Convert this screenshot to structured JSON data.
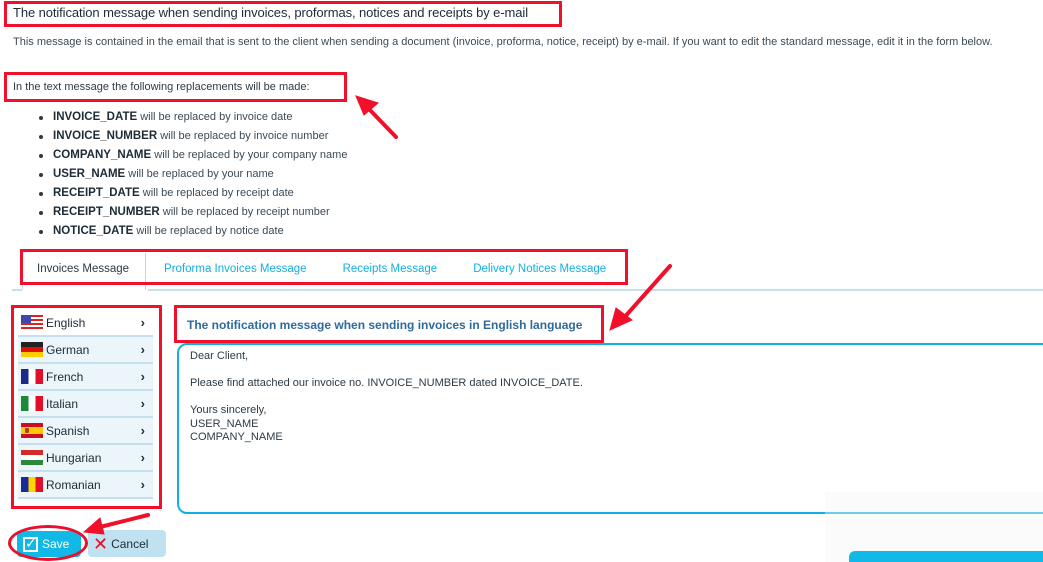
{
  "page": {
    "title": "The notification message when sending invoices, proformas, notices and receipts by e-mail",
    "description": "This message is contained in the email that is sent to the client when sending a document (invoice, proforma, notice, receipt) by e-mail. If you want to edit the standard message, edit it in the form below.",
    "replacements_intro": "In the text message the following replacements will be made:",
    "replacements": [
      {
        "token": "INVOICE_DATE",
        "text": " will be replaced by invoice date"
      },
      {
        "token": "INVOICE_NUMBER",
        "text": " will be replaced by invoice number"
      },
      {
        "token": "COMPANY_NAME",
        "text": " will be replaced by your company name"
      },
      {
        "token": "USER_NAME",
        "text": " will be replaced by your name"
      },
      {
        "token": "RECEIPT_DATE",
        "text": " will be replaced by receipt date"
      },
      {
        "token": "RECEIPT_NUMBER",
        "text": " will be replaced by receipt number"
      },
      {
        "token": "NOTICE_DATE",
        "text": " will be replaced by notice date"
      }
    ]
  },
  "tabs": [
    {
      "label": "Invoices Message",
      "active": true
    },
    {
      "label": "Proforma Invoices Message",
      "active": false
    },
    {
      "label": "Receipts Message",
      "active": false
    },
    {
      "label": "Delivery Notices Message",
      "active": false
    }
  ],
  "languages": [
    {
      "label": "English",
      "flag": "us-flag-icon",
      "chevron": "›"
    },
    {
      "label": "German",
      "flag": "germany-flag-icon",
      "chevron": "›"
    },
    {
      "label": "French",
      "flag": "france-flag-icon",
      "chevron": "›"
    },
    {
      "label": "Italian",
      "flag": "italy-flag-icon",
      "chevron": "›"
    },
    {
      "label": "Spanish",
      "flag": "spain-flag-icon",
      "chevron": "›"
    },
    {
      "label": "Hungarian",
      "flag": "hungary-flag-icon",
      "chevron": "›"
    },
    {
      "label": "Romanian",
      "flag": "romania-flag-icon",
      "chevron": "›"
    }
  ],
  "editor": {
    "heading": "The notification message when sending invoices in English language",
    "message": "Dear Client,\n\nPlease find attached our invoice no. INVOICE_NUMBER dated INVOICE_DATE.\n\nYours sincerely,\nUSER_NAME\nCOMPANY_NAME"
  },
  "buttons": {
    "save_label": "Save",
    "save_icon": "checkbox-check-icon",
    "cancel_label": "Cancel",
    "cancel_icon": "x-icon"
  },
  "colors": {
    "accent": "#12b8e6",
    "tab_link": "#12b0e0",
    "heading_blue": "#2e6a9a",
    "annotation_red": "#f0102a",
    "divider": "#c4e0ee"
  }
}
